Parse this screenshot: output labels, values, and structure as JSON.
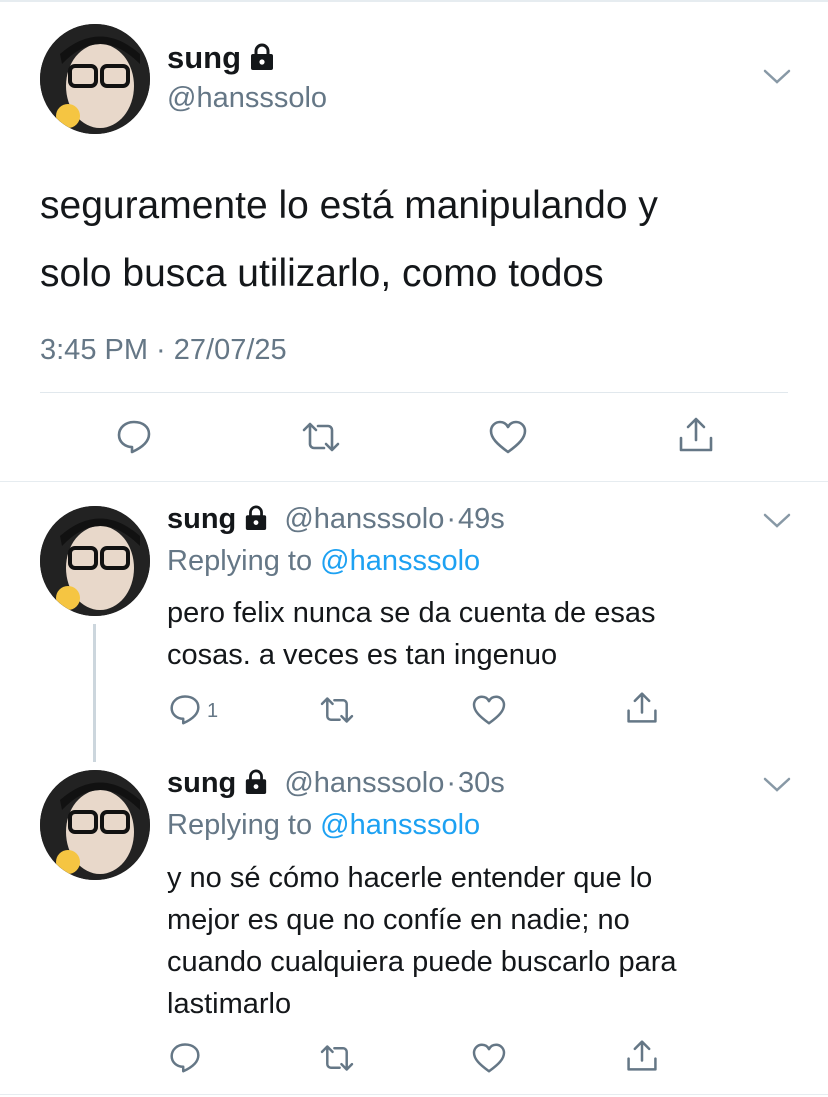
{
  "main_tweet": {
    "display_name": "sung",
    "handle": "@hansssolo",
    "text_line1": "seguramente lo está manipulando y",
    "text_line2": "solo busca utilizarlo, como todos",
    "timestamp": "3:45 PM · 27/07/25"
  },
  "replies": [
    {
      "display_name": "sung",
      "handle": "@hansssolo",
      "time": "49s",
      "replying_prefix": "Replying to",
      "replying_to": "@hansssolo",
      "lines": [
        "pero felix nunca se da cuenta de esas",
        "cosas. a veces es tan ingenuo"
      ],
      "reply_count": "1"
    },
    {
      "display_name": "sung",
      "handle": "@hansssolo",
      "time": "30s",
      "replying_prefix": "Replying to",
      "replying_to": "@hansssolo",
      "lines": [
        "y no sé cómo hacerle entender que lo",
        "mejor es que no confíe en nadie; no",
        "cuando cualquiera puede buscarlo para",
        "lastimarlo"
      ]
    }
  ],
  "separator": "·",
  "icons": {
    "reply": "reply-icon",
    "retweet": "retweet-icon",
    "like": "heart-icon",
    "share": "share-icon",
    "lock": "lock-icon",
    "menu": "chevron-down-icon"
  },
  "colors": {
    "text": "#14171a",
    "muted": "#657786",
    "link": "#1da1f2",
    "divider": "#e1e8ed"
  }
}
